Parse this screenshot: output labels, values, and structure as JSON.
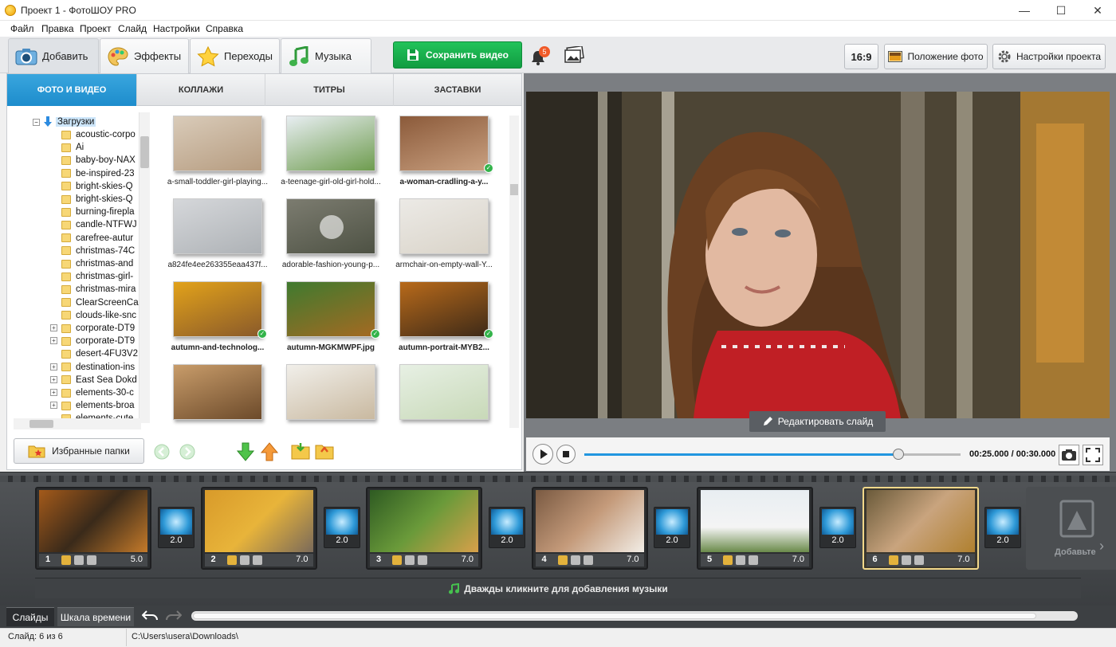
{
  "window": {
    "title": "Проект 1 - ФотоШОУ PRO",
    "minimize": "—",
    "maximize": "☐",
    "close": "✕"
  },
  "menu": [
    "Файл",
    "Правка",
    "Проект",
    "Слайд",
    "Настройки",
    "Справка"
  ],
  "main_tabs": [
    "Добавить",
    "Эффекты",
    "Переходы",
    "Музыка"
  ],
  "save_button": "Сохранить видео",
  "notifications": {
    "count": "5"
  },
  "aspect_ratio": "16:9",
  "photo_position": "Положение фото",
  "project_settings": "Настройки проекта",
  "sub_tabs": [
    "ФОТО И ВИДЕО",
    "КОЛЛАЖИ",
    "ТИТРЫ",
    "ЗАСТАВКИ"
  ],
  "tree": {
    "root": "Загрузки",
    "items": [
      "acoustic-corpo",
      "Ai",
      "baby-boy-NAX",
      "be-inspired-23",
      "bright-skies-Q",
      "bright-skies-Q",
      "burning-firepla",
      "candle-NTFWJ",
      "carefree-autur",
      "christmas-74C",
      "christmas-and",
      "christmas-girl-",
      "christmas-mira",
      "ClearScreenCa",
      "clouds-like-snc",
      "corporate-DT9",
      "corporate-DT9",
      "desert-4FU3V2",
      "destination-ins",
      "East Sea Dokd",
      "elements-30-c",
      "elements-broa",
      "elements-cute"
    ]
  },
  "files": [
    {
      "name": "a-small-toddler-girl-playing...",
      "bold": false,
      "checked": false
    },
    {
      "name": "a-teenage-girl-old-girl-hold...",
      "bold": false,
      "checked": false
    },
    {
      "name": "a-woman-cradling-a-y...",
      "bold": true,
      "checked": true
    },
    {
      "name": "a824fe4ee263355eaa437f...",
      "bold": false,
      "checked": false
    },
    {
      "name": "adorable-fashion-young-p...",
      "bold": false,
      "checked": false
    },
    {
      "name": "armchair-on-empty-wall-Y...",
      "bold": false,
      "checked": false
    },
    {
      "name": "autumn-and-technolog...",
      "bold": true,
      "checked": true
    },
    {
      "name": "autumn-MGKMWPF.jpg",
      "bold": true,
      "checked": true
    },
    {
      "name": "autumn-portrait-MYB2...",
      "bold": true,
      "checked": true
    },
    {
      "name": "",
      "bold": false,
      "checked": false
    },
    {
      "name": "",
      "bold": false,
      "checked": false
    },
    {
      "name": "",
      "bold": false,
      "checked": false
    }
  ],
  "favorites_button": "Избранные папки",
  "edit_slide": "Редактировать слайд",
  "player": {
    "time": "00:25.000 / 00:30.000",
    "progress": 0.8333
  },
  "slides": [
    {
      "num": "1",
      "duration": "5.0",
      "transition": "2.0",
      "selected": false
    },
    {
      "num": "2",
      "duration": "7.0",
      "transition": "2.0",
      "selected": false
    },
    {
      "num": "3",
      "duration": "7.0",
      "transition": "2.0",
      "selected": false
    },
    {
      "num": "4",
      "duration": "7.0",
      "transition": "2.0",
      "selected": false
    },
    {
      "num": "5",
      "duration": "7.0",
      "transition": "2.0",
      "selected": false
    },
    {
      "num": "6",
      "duration": "7.0",
      "transition": "2.0",
      "selected": true
    }
  ],
  "add_slide": "Добавьте",
  "music_hint": "Дважды кликните для добавления музыки",
  "bottom_tabs": [
    "Слайды",
    "Шкала времени"
  ],
  "status": {
    "slide": "Слайд: 6 из 6",
    "path": "C:\\Users\\usera\\Downloads\\"
  },
  "colors": {
    "accent": "#1d8ccc",
    "save": "#119c41",
    "badge": "#f05a28",
    "selected_slide": "#f2d88a"
  }
}
